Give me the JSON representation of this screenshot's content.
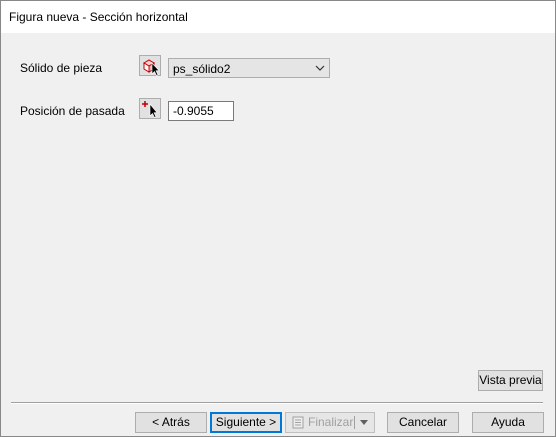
{
  "window": {
    "title": "Figura nueva - Sección horizontal"
  },
  "form": {
    "solid_label": "Sólido de pieza",
    "solid_value": "ps_sólido2",
    "position_label": "Posición de pasada",
    "position_value": "-0.9055"
  },
  "preview_button": "Vista previa",
  "footer": {
    "back": "< Atrás",
    "next": "Siguiente >",
    "finish": "Finalizar",
    "cancel": "Cancelar",
    "help": "Ayuda"
  },
  "colors": {
    "focus_border": "#0078d7",
    "icon_red": "#c00000"
  }
}
